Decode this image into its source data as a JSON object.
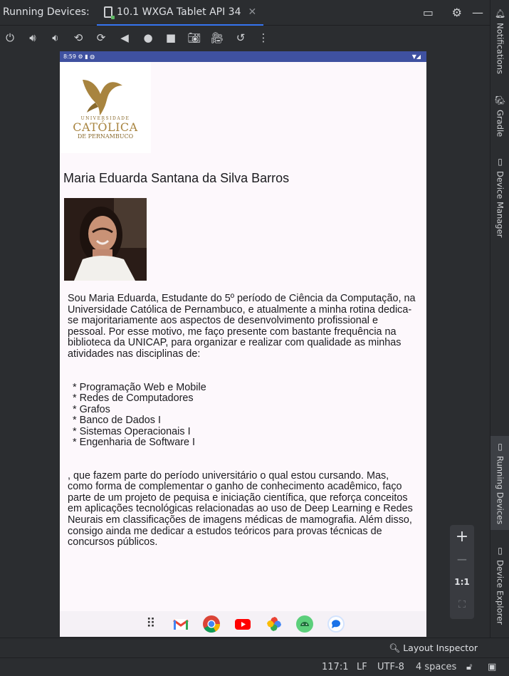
{
  "toolwindow": {
    "title": "Running Devices:",
    "tab_label": "10.1 WXGA Tablet API 34",
    "tab_close": "✕"
  },
  "toolbar_icons": [
    "power-icon",
    "volume-up-icon",
    "volume-down-icon",
    "rotate-left-icon",
    "rotate-right-icon",
    "back-icon",
    "home-icon",
    "overview-icon",
    "camera-icon",
    "screen-record-icon",
    "reset-icon",
    "more-icon"
  ],
  "device": {
    "status_time": "8:59",
    "logo": {
      "line1": "UNIVERSIDADE",
      "line2": "CATÓLICA",
      "line3": "DE PERNAMBUCO"
    },
    "name": "Maria Eduarda Santana da Silva Barros",
    "bio_intro": "Sou Maria Eduarda, Estudante do 5º período de Ciência da Computação, na Universidade Católica de Pernambuco, e atualmente a minha rotina dedica-se majoritariamente aos aspectos de desenvolvimento profissional e pessoal. Por esse motivo, me faço presente com bastante frequência na biblioteca da UNICAP, para organizar e realizar com qualidade as minhas atividades nas disciplinas de:",
    "subjects": [
      "* Programação Web e Mobile",
      "* Redes de Computadores",
      "* Grafos",
      "* Banco de Dados I",
      "* Sistemas Operacionais I",
      "* Engenharia de Software I"
    ],
    "bio_outro": ", que fazem parte do período universitário o qual estou cursando. Mas, como forma de complementar o ganho de conhecimento acadêmico, faço parte de um projeto de pequisa e iniciação científica, que reforça conceitos em aplicações tecnológicas relacionadas ao uso de Deep Learning e Redes Neurais em classificações de imagens médicas de mamografia. Além disso, consigo ainda me dedicar a estudos teóricos para provas técnicas de concursos públicos."
  },
  "right_tabs": {
    "notifications": "Notifications",
    "gradle": "Gradle",
    "device_manager": "Device Manager",
    "running_devices": "Running Devices",
    "device_explorer": "Device Explorer"
  },
  "zoom": {
    "plus": "+",
    "minus": "−",
    "one_to_one": "1:1"
  },
  "layout_inspector": "Layout Inspector",
  "statusbar": {
    "position": "117:1",
    "line_sep": "LF",
    "encoding": "UTF-8",
    "indent": "4 spaces"
  },
  "colors": {
    "ide_bg": "#2b2d30",
    "accent": "#3574f0",
    "logo_gold": "#a8843f",
    "status_bar": "#3f51a0"
  }
}
